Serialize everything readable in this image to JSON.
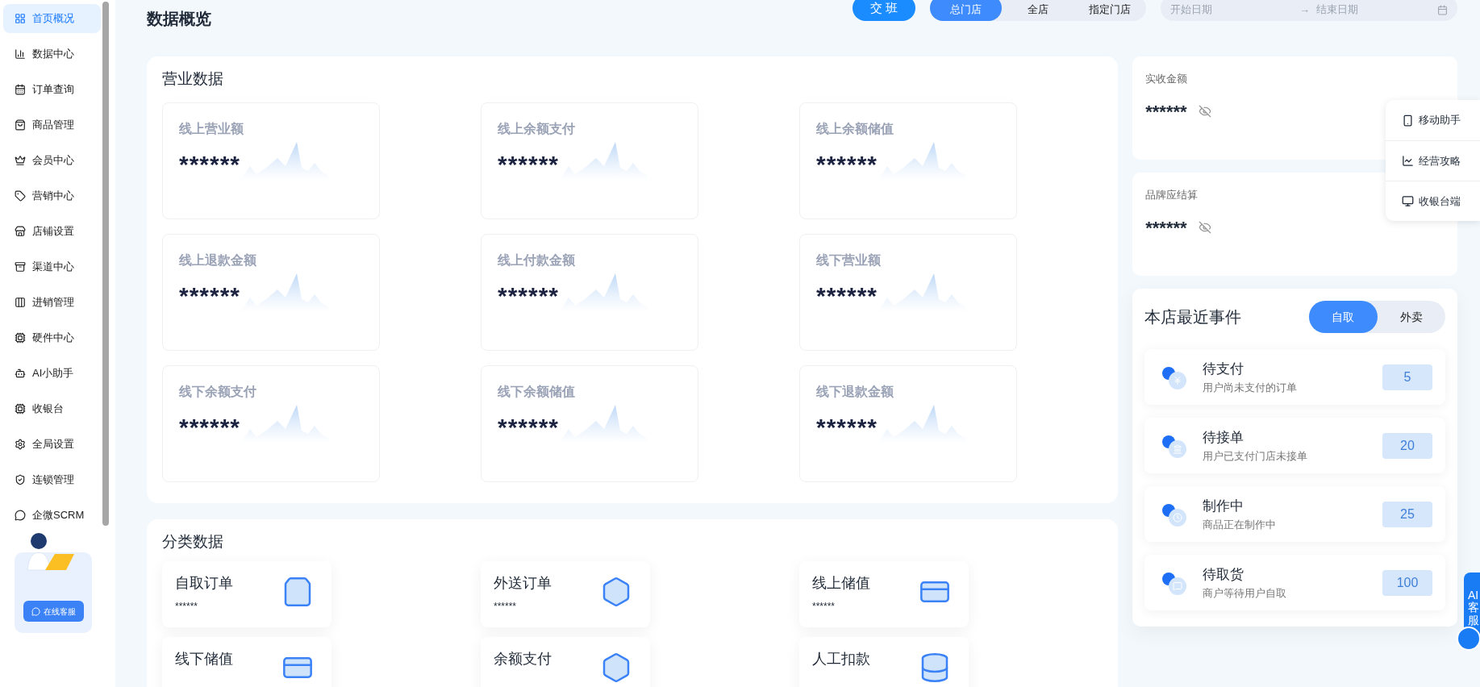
{
  "sidebar": {
    "items": [
      {
        "label": "首页概况",
        "selected": true
      },
      {
        "label": "数据中心",
        "selected": false
      },
      {
        "label": "订单查询",
        "selected": false
      },
      {
        "label": "商品管理",
        "selected": false
      },
      {
        "label": "会员中心",
        "selected": false
      },
      {
        "label": "营销中心",
        "selected": false
      },
      {
        "label": "店铺设置",
        "selected": false
      },
      {
        "label": "渠道中心",
        "selected": false
      },
      {
        "label": "进销管理",
        "selected": false
      },
      {
        "label": "硬件中心",
        "selected": false
      },
      {
        "label": "AI小助手",
        "selected": false
      },
      {
        "label": "收银台",
        "selected": false
      },
      {
        "label": "全局设置",
        "selected": false
      },
      {
        "label": "连锁管理",
        "selected": false
      },
      {
        "label": "企微SCRM",
        "selected": false
      }
    ],
    "support_button": "在线客服"
  },
  "header": {
    "title": "数据概览",
    "shift_button": "交 班",
    "store_tabs": [
      {
        "label": "总门店",
        "selected": true
      },
      {
        "label": "全店",
        "selected": false
      },
      {
        "label": "指定门店",
        "selected": false
      }
    ],
    "date_range": {
      "start_placeholder": "开始日期",
      "separator": "→",
      "end_placeholder": "结束日期"
    }
  },
  "business_data": {
    "title": "营业数据",
    "cards": [
      {
        "label": "线上营业额",
        "value": "******"
      },
      {
        "label": "线上余额支付",
        "value": "******"
      },
      {
        "label": "线上余额储值",
        "value": "******"
      },
      {
        "label": "线上退款金额",
        "value": "******"
      },
      {
        "label": "线上付款金额",
        "value": "******"
      },
      {
        "label": "线下营业额",
        "value": "******"
      },
      {
        "label": "线下余额支付",
        "value": "******"
      },
      {
        "label": "线下余额储值",
        "value": "******"
      },
      {
        "label": "线下退款金额",
        "value": "******"
      }
    ]
  },
  "category_data": {
    "title": "分类数据",
    "cards": [
      {
        "label": "自取订单",
        "value": "******"
      },
      {
        "label": "外送订单",
        "value": "******"
      },
      {
        "label": "线上储值",
        "value": "******"
      },
      {
        "label": "线下储值"
      },
      {
        "label": "余额支付"
      },
      {
        "label": "人工扣款"
      }
    ]
  },
  "summary_cards": [
    {
      "label": "实收金额",
      "value": "******"
    },
    {
      "label": "品牌应结算",
      "value": "******"
    }
  ],
  "events": {
    "title": "本店最近事件",
    "tabs": [
      {
        "label": "自取",
        "selected": true
      },
      {
        "label": "外卖",
        "selected": false
      }
    ],
    "items": [
      {
        "title": "待支付",
        "description": "用户尚未支付的订单",
        "count": "5"
      },
      {
        "title": "待接单",
        "description": "用户已支付门店未接单",
        "count": "20"
      },
      {
        "title": "制作中",
        "description": "商品正在制作中",
        "count": "25"
      },
      {
        "title": "待取货",
        "description": "商户等待用户自取",
        "count": "100"
      }
    ]
  },
  "floating_menu": [
    {
      "label": "移动助手"
    },
    {
      "label": "经营攻略"
    },
    {
      "label": "收银台端"
    }
  ],
  "ai_service": "AI客服"
}
